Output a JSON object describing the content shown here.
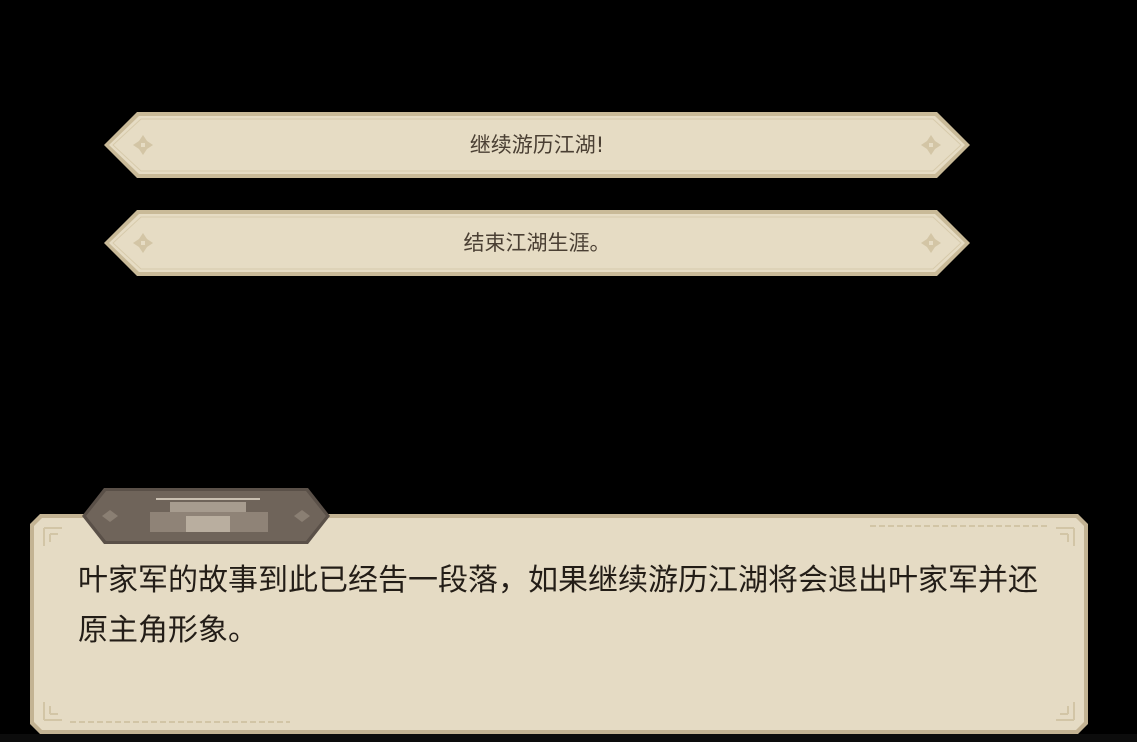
{
  "choices": [
    {
      "label": "继续游历江湖!"
    },
    {
      "label": "结束江湖生涯。"
    }
  ],
  "dialog": {
    "text": "叶家军的故事到此已经告一段落，如果继续游历江湖将会退出叶家军并还原主角形象。"
  },
  "colors": {
    "background": "#000000",
    "panel_fill": "#e5dbc4",
    "panel_border": "#c4b595",
    "text": "#231d17",
    "nameplate": "#6d6259"
  }
}
